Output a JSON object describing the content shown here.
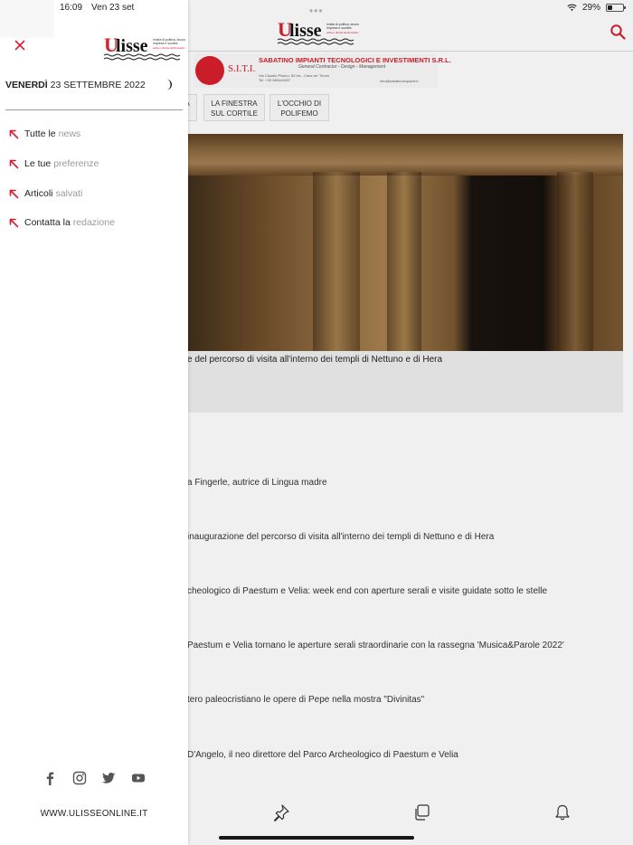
{
  "status_bar": {
    "time": "16:09",
    "date": "Ven 23 set",
    "battery": "29%",
    "battery_level": 0.29
  },
  "logo": {
    "name": "ulisse",
    "tagline_lines": [
      "rivista di politica, lavoro",
      "impresa e società",
      "edita e diretta da Rossella Sorella"
    ]
  },
  "header": {
    "search_icon": "search-icon"
  },
  "banner": {
    "short_name": "S.I.T.I.",
    "company": "SABATINO IMPIANTI TECNOLOGICI E INVESTIMENTI S.R.L.",
    "tagline": "General Contractor - Design - Management",
    "address": "Via Claudio Pisano, 83 bis - Cava de' Tirreni",
    "phone": "Tel. +39 089444637",
    "email": "info@sabatinoimpianti.it"
  },
  "categories": [
    {
      "label": "A"
    },
    {
      "label": "LA FINESTRA SUL CORTILE"
    },
    {
      "label": "L'OCCHIO DI POLIFEMO"
    }
  ],
  "hero": {
    "caption": "e del percorso di visita all'interno dei templi di Nettuno e di Hera"
  },
  "news": [
    "a Fingerle, autrice di Lingua madre",
    "inaugurazione del percorso di visita all'interno dei templi di Nettuno e di Hera",
    "cheologico di Paestum e Velia: week end con aperture serali e visite guidate sotto le stelle",
    "Paestum e Velia tornano le aperture serali straordinarie con la rassegna 'Musica&Parole 2022'",
    "tero paleocristiano le opere di Pepe nella mostra \"Divinitas\"",
    "D'Angelo, il neo direttore del Parco Archeologico di Paestum e Velia"
  ],
  "bottom_tabs": [
    {
      "icon": "pin-icon"
    },
    {
      "icon": "copy-icon"
    },
    {
      "icon": "bell-icon"
    }
  ],
  "drawer": {
    "weekday": "Venerdì",
    "date": "23 settembre 2022",
    "menu": [
      {
        "strong": "Tutte le",
        "light": "news",
        "icon": "arrow-up-left-icon"
      },
      {
        "strong": "Le tue",
        "light": "preferenze",
        "icon": "arrow-up-left-icon"
      },
      {
        "strong": "Articoli",
        "light": "salvati",
        "icon": "arrow-up-left-icon"
      },
      {
        "strong": "Contatta la",
        "light": "redazione",
        "icon": "arrow-up-left-icon"
      }
    ],
    "social": [
      "facebook-icon",
      "instagram-icon",
      "twitter-icon",
      "youtube-icon"
    ],
    "site_url": "www.ulisseonline.it"
  },
  "colors": {
    "brand_red": "#d81e2c",
    "accent_arrow": "#d81e2c",
    "text": "#222222",
    "muted": "#999999"
  }
}
